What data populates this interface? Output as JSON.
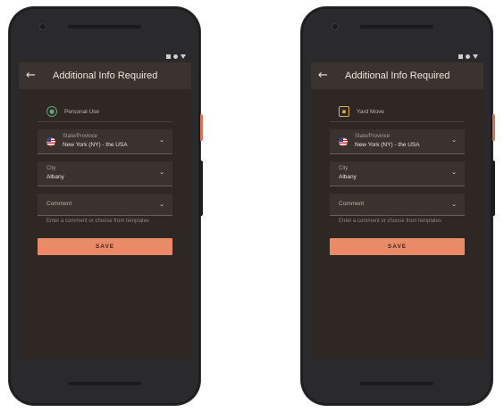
{
  "phones": [
    {
      "title": "Additional Info Required",
      "use_label": "Personal Use",
      "use_icon": "personal-use-icon",
      "state_label": "State/Province",
      "state_value": "New York (NY) - the USA",
      "city_label": "City",
      "city_value": "Albany",
      "comment_label": "Comment",
      "comment_hint": "Enter a comment or choose from templates",
      "save_label": "SAVE"
    },
    {
      "title": "Additional Info Required",
      "use_label": "Yard Move",
      "use_icon": "yard-move-icon",
      "state_label": "State/Province",
      "state_value": "New York (NY) - the USA",
      "city_label": "City",
      "city_value": "Albany",
      "comment_label": "Comment",
      "comment_hint": "Enter a comment or choose from templates",
      "save_label": "SAVE"
    }
  ],
  "colors": {
    "accent": "#ea8a66",
    "screen_bg": "#2e2724",
    "app_bar": "#3b332f",
    "personal_use": "#5ea27c",
    "yard_move": "#d9b24a"
  }
}
